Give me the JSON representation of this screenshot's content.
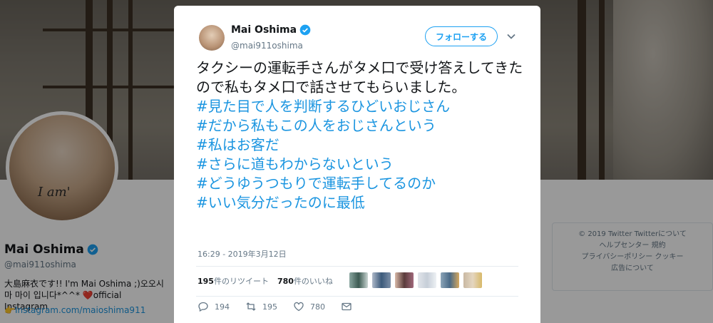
{
  "profile": {
    "name": "Mai Oshima",
    "handle": "@mai911oshima",
    "bio": "大島麻衣です!! I'm Mai Oshima ;)오오시마 마이 입니다*^^* ❤️official Instagram",
    "link": "👉Instagram.com/maioshima911",
    "avatar_mark": "I am'"
  },
  "footer": {
    "line1": "© 2019 Twitter   Twitterについて",
    "line2": "ヘルプセンター   規約",
    "line3": "プライバシーポリシー   クッキー",
    "line4": "広告について"
  },
  "tweet": {
    "author_name": "Mai Oshima",
    "author_handle": "@mai911oshima",
    "follow_label": "フォローする",
    "body": "タクシーの運転手さんがタメ口で受け答えしてきたので私もタメ口で話させてもらいました。",
    "hashtags": [
      "#見た目で人を判断するひどいおじさん",
      "#だから私もこの人をおじさんという",
      "#私はお客だ",
      "#さらに道もわからないという",
      "#どうゆうつもりで運転手してるのか",
      "#いい気分だったのに最低"
    ],
    "timestamp": "16:29 - 2019年3月12日",
    "retweet_count": "195",
    "retweet_label": "件のリツイート",
    "like_count": "780",
    "like_label": "件のいいね",
    "actions": {
      "reply_count": "194",
      "retweet_count": "195",
      "like_count": "780"
    }
  },
  "colors": {
    "accent": "#1da1f2",
    "hashtag": "#1b95e0",
    "verified": "#1da1f2"
  }
}
